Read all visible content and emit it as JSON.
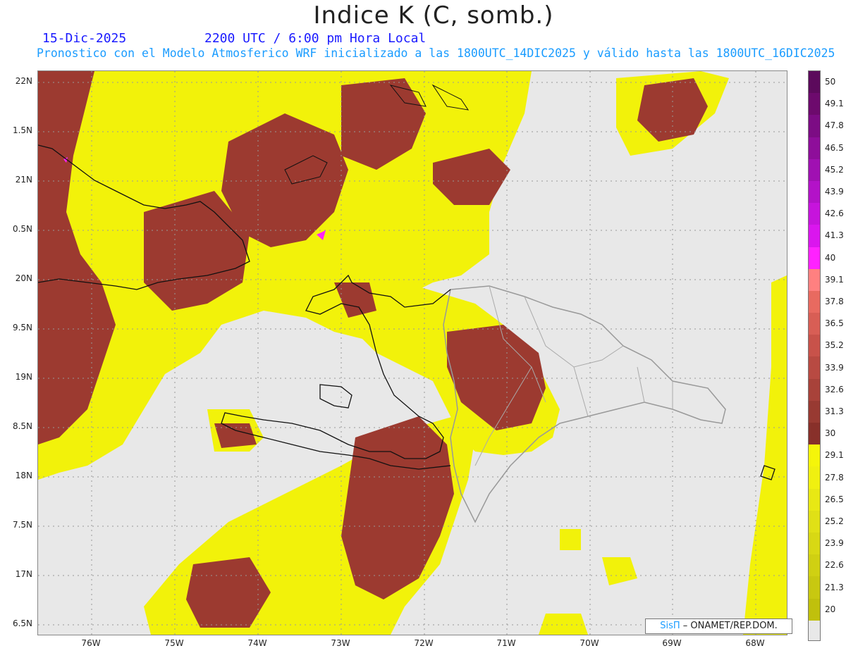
{
  "header": {
    "title": "Indice K (C, somb.)",
    "date": "15-Dic-2025",
    "time": "2200 UTC / 6:00 pm Hora Local",
    "subtitle": "Pronostico con el Modelo Atmosferico WRF inicializado a las 1800UTC_14DIC2025 y válido hasta las  1800UTC_16DIC2025"
  },
  "axes": {
    "y_labels": [
      "22N",
      "1.5N",
      "21N",
      "0.5N",
      "20N",
      "9.5N",
      "19N",
      "8.5N",
      "18N",
      "7.5N",
      "17N",
      "6.5N"
    ],
    "x_labels": [
      "76W",
      "75W",
      "74W",
      "73W",
      "72W",
      "71W",
      "70W",
      "69W",
      "68W"
    ]
  },
  "colorbar": {
    "labels": [
      "50",
      "49.1",
      "47.8",
      "46.5",
      "45.2",
      "43.9",
      "42.6",
      "41.3",
      "40",
      "39.1",
      "37.8",
      "36.5",
      "35.2",
      "33.9",
      "32.6",
      "31.3",
      "30",
      "29.1",
      "27.8",
      "26.5",
      "25.2",
      "23.9",
      "22.6",
      "21.3",
      "20"
    ],
    "colors": [
      "#5c0a5c",
      "#6d0a6d",
      "#7c0c84",
      "#8e0e9a",
      "#a010b2",
      "#b312c8",
      "#c614dc",
      "#da16ee",
      "#ff22ff",
      "#ff8080",
      "#e86a60",
      "#d85e55",
      "#c8524a",
      "#b84a42",
      "#a8423a",
      "#983a32",
      "#88302a",
      "#f5f50a",
      "#f0f010",
      "#e8e814",
      "#e0e016",
      "#d8d814",
      "#d0d012",
      "#c8c810",
      "#c0c00c"
    ],
    "empty_color": "#e8e8e8"
  },
  "credit": {
    "brand": "SisΠ",
    "text": " – ONAMET/REP.DOM."
  }
}
